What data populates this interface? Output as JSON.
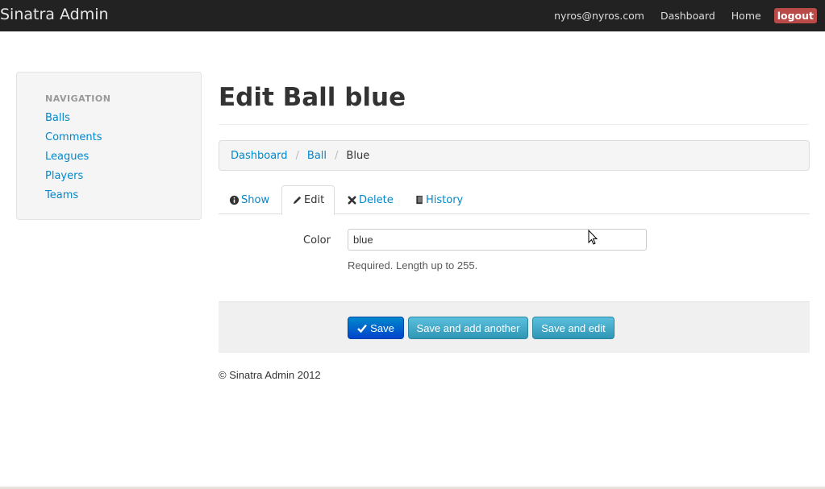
{
  "navbar": {
    "brand": "Sinatra Admin",
    "user_email": "nyros@nyros.com",
    "dashboard": "Dashboard",
    "home": "Home",
    "logout": "logout"
  },
  "sidebar": {
    "header": "NAVIGATION",
    "items": [
      {
        "label": "Balls"
      },
      {
        "label": "Comments"
      },
      {
        "label": "Leagues"
      },
      {
        "label": "Players"
      },
      {
        "label": "Teams"
      }
    ]
  },
  "page": {
    "title": "Edit Ball blue"
  },
  "breadcrumb": {
    "items": [
      "Dashboard",
      "Ball",
      "Blue"
    ],
    "separator": "/"
  },
  "tabs": [
    {
      "label": "Show",
      "icon": "info-icon"
    },
    {
      "label": "Edit",
      "icon": "pencil-icon",
      "active": true
    },
    {
      "label": "Delete",
      "icon": "remove-icon"
    },
    {
      "label": "History",
      "icon": "book-icon"
    }
  ],
  "form": {
    "color_label": "Color",
    "color_value": "blue",
    "color_help": "Required. Length up to 255."
  },
  "actions": {
    "save": "Save",
    "save_add": "Save and add another",
    "save_edit": "Save and edit"
  },
  "footer": {
    "text": "© Sinatra Admin 2012"
  },
  "colors": {
    "navbar_bg": "#222222",
    "link": "#0088cc",
    "logout_bg": "#b94a48",
    "primary_btn": "#0055cc",
    "info_btn": "#49afcd"
  }
}
